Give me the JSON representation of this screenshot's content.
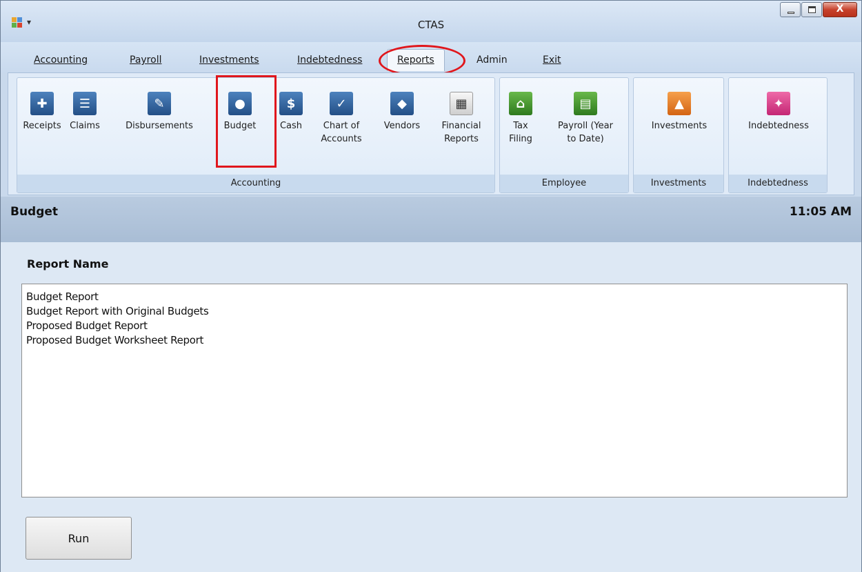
{
  "window": {
    "title": "CTAS",
    "quick_access": "▾"
  },
  "menu": {
    "tabs": [
      {
        "label": "Accounting",
        "active": false
      },
      {
        "label": "Payroll",
        "active": false
      },
      {
        "label": "Investments",
        "active": false
      },
      {
        "label": "Indebtedness",
        "active": false
      },
      {
        "label": "Reports",
        "active": true
      },
      {
        "label": "Admin",
        "active": false
      },
      {
        "label": "Exit",
        "active": false
      }
    ]
  },
  "ribbon": {
    "groups": [
      {
        "label": "Accounting",
        "buttons": [
          {
            "line1": "Receipts",
            "line2": "",
            "icon": "receipts-icon"
          },
          {
            "line1": "Claims",
            "line2": "",
            "icon": "claims-icon"
          },
          {
            "line1": "Disbursements",
            "line2": "",
            "icon": "disbursements-icon"
          },
          {
            "line1": "Budget",
            "line2": "",
            "icon": "piggy-bank-icon"
          },
          {
            "line1": "Cash",
            "line2": "",
            "icon": "cash-icon"
          },
          {
            "line1": "Chart of",
            "line2": "Accounts",
            "icon": "chart-of-accounts-icon"
          },
          {
            "line1": "Vendors",
            "line2": "",
            "icon": "handshake-icon"
          },
          {
            "line1": "Financial",
            "line2": "Reports",
            "icon": "calculator-icon"
          }
        ]
      },
      {
        "label": "Employee",
        "buttons": [
          {
            "line1": "Tax",
            "line2": "Filing",
            "icon": "bank-icon"
          },
          {
            "line1": "Payroll (Year",
            "line2": "to Date)",
            "icon": "payroll-document-icon"
          }
        ]
      },
      {
        "label": "Investments",
        "buttons": [
          {
            "line1": "Investments",
            "line2": "",
            "icon": "investments-chart-icon"
          }
        ]
      },
      {
        "label": "Indebtedness",
        "buttons": [
          {
            "line1": "Indebtedness",
            "line2": "",
            "icon": "indebtedness-icon"
          }
        ]
      }
    ]
  },
  "header": {
    "title": "Budget",
    "time": "11:05 AM"
  },
  "report_list": {
    "column_header": "Report Name",
    "items": [
      "Budget Report",
      "Budget Report with Original Budgets",
      "Proposed Budget Report",
      "Proposed Budget Worksheet Report"
    ]
  },
  "run_button": {
    "label": "Run"
  },
  "colors": {
    "highlight": "#e0161c",
    "ribbon_bg": "#dfeaf7",
    "header_bg": "#b9cbe0"
  }
}
